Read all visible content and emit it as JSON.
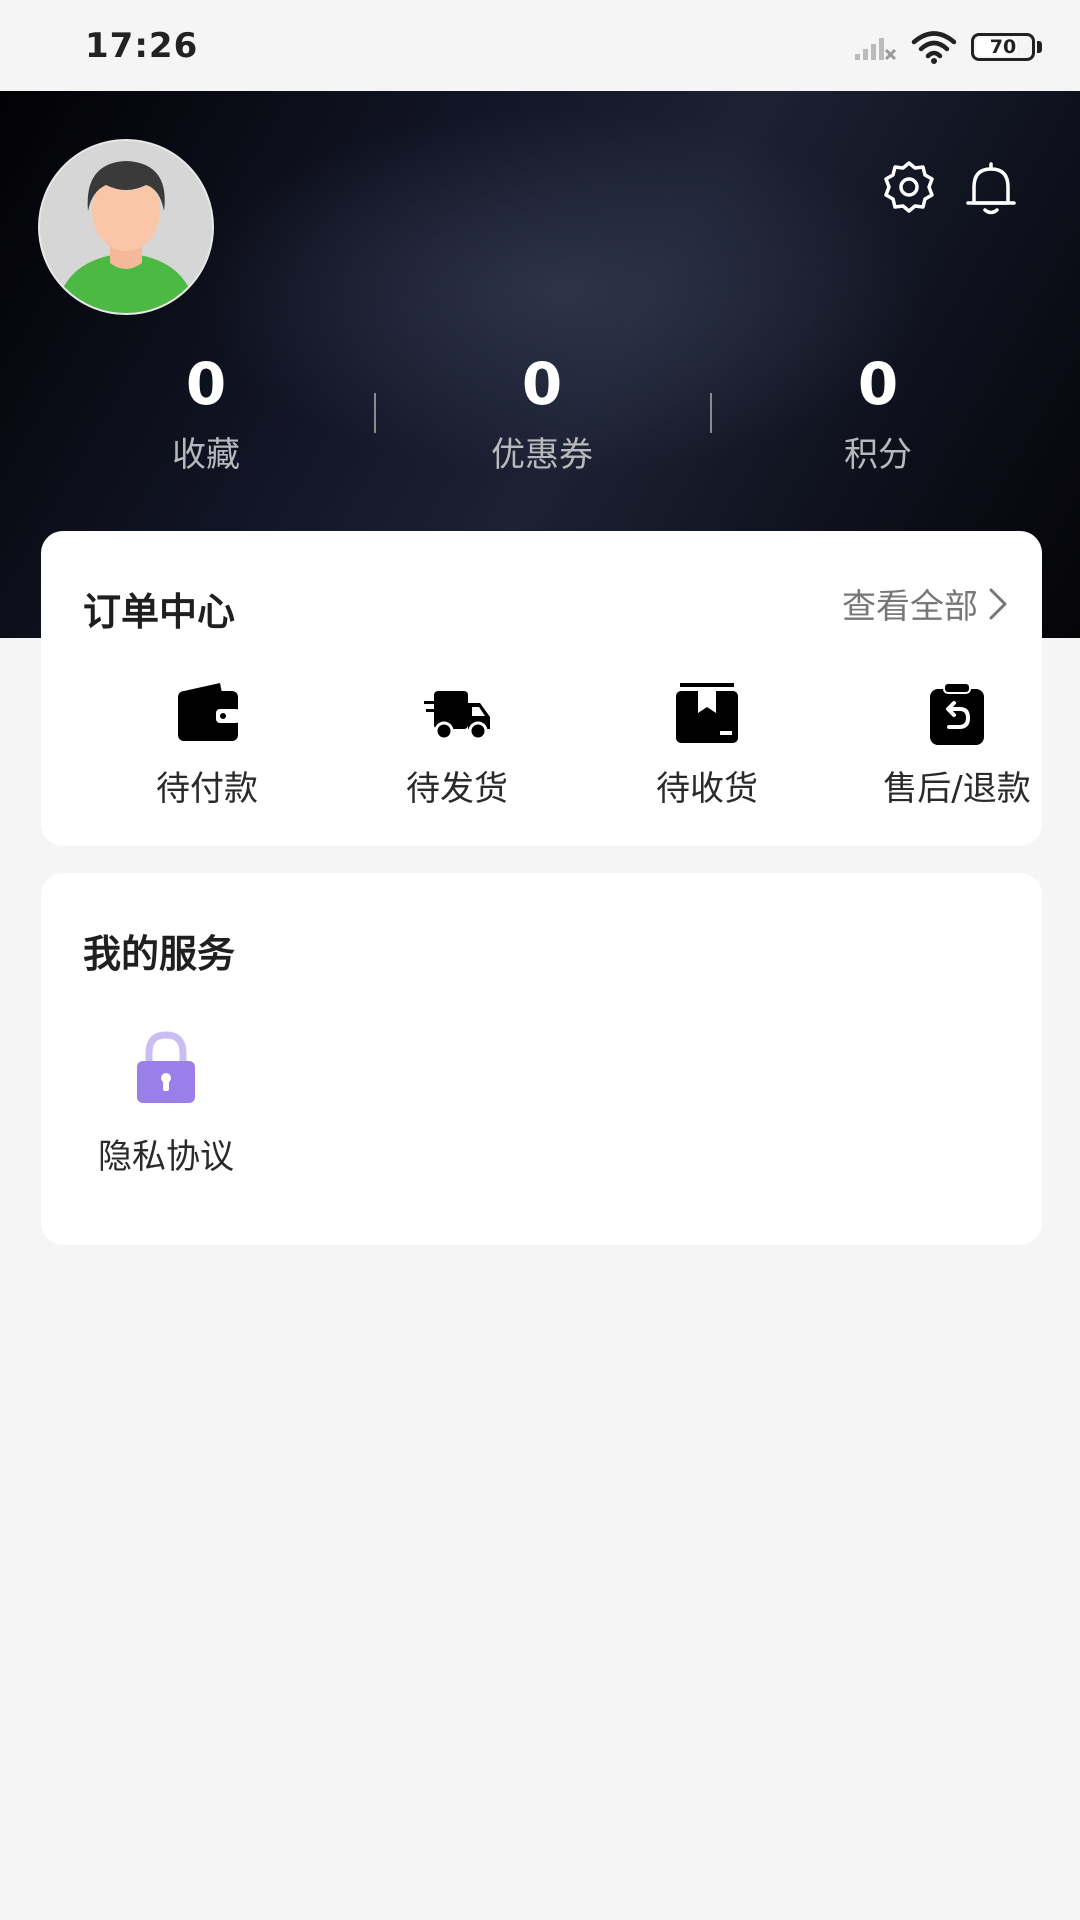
{
  "status_bar": {
    "time": "17:26",
    "battery": "70"
  },
  "header": {
    "stats": [
      {
        "value": "0",
        "label": "收藏"
      },
      {
        "value": "0",
        "label": "优惠券"
      },
      {
        "value": "0",
        "label": "积分"
      }
    ],
    "icons": [
      "settings-icon",
      "bell-icon"
    ]
  },
  "order_center": {
    "title": "订单中心",
    "view_all": "查看全部",
    "items": [
      {
        "label": "待付款",
        "icon": "wallet-icon"
      },
      {
        "label": "待发货",
        "icon": "truck-icon"
      },
      {
        "label": "待收货",
        "icon": "box-icon"
      },
      {
        "label": "售后/退款",
        "icon": "refund-clipboard-icon"
      }
    ]
  },
  "my_services": {
    "title": "我的服务",
    "items": [
      {
        "label": "隐私协议",
        "icon": "lock-icon",
        "color": "#9b7fe8"
      }
    ]
  }
}
